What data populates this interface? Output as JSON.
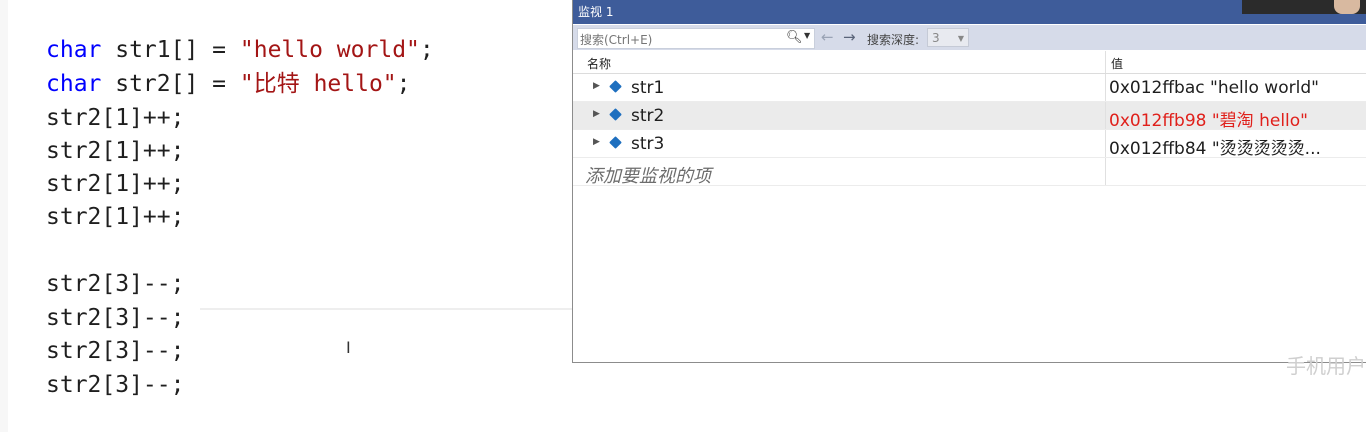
{
  "editor": {
    "lines": [
      {
        "kw": "char",
        "rest": " str1[] = ",
        "str": "\"hello world\"",
        "end": ";"
      },
      {
        "kw": "char",
        "rest": " str2[] = ",
        "str": "\"比特 hello\"",
        "end": ";"
      },
      {
        "text": "str2[1]++;"
      },
      {
        "text": "str2[1]++;"
      },
      {
        "text": "str2[1]++;"
      },
      {
        "text": "str2[1]++;"
      },
      {
        "text": "str2[3]--;"
      },
      {
        "text": "str2[3]--;"
      },
      {
        "text": "str2[3]--;"
      },
      {
        "text": "str2[3]--;"
      }
    ]
  },
  "watch": {
    "title": "监视 1",
    "search_placeholder": "搜索(Ctrl+E)",
    "search_icon": "search-icon",
    "depth_label": "搜索深度:",
    "depth_value": "3",
    "columns": {
      "name": "名称",
      "value": "值"
    },
    "rows": [
      {
        "name": "str1",
        "value": "0x012ffbac \"hello world\"",
        "changed": false
      },
      {
        "name": "str2",
        "value": "0x012ffb98 \"碧淘 hello\"",
        "changed": true
      },
      {
        "name": "str3",
        "value": "0x012ffb84 \"烫烫烫烫烫...",
        "changed": false
      }
    ],
    "add_item_placeholder": "添加要监视的项",
    "changed_color": "#e0201b",
    "title_color": "#3e5c9a"
  },
  "overlay": {
    "text": "手机用户"
  }
}
